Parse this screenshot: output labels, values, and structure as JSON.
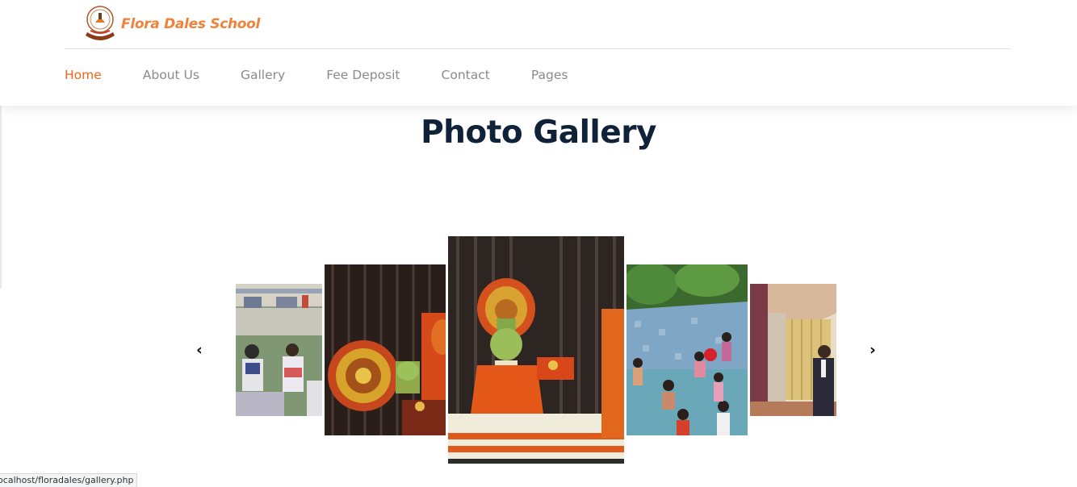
{
  "header": {
    "brand": "Flora Dales School",
    "nav": [
      {
        "label": "Home",
        "active": true
      },
      {
        "label": "About Us",
        "active": false
      },
      {
        "label": "Gallery",
        "active": false
      },
      {
        "label": "Fee Deposit",
        "active": false
      },
      {
        "label": "Contact",
        "active": false
      },
      {
        "label": "Pages",
        "active": false
      }
    ]
  },
  "main": {
    "title": "Photo Gallery",
    "carousel": {
      "prev_icon": "‹",
      "next_icon": "›",
      "slides": [
        {
          "subject": "students-reading-on-lawn"
        },
        {
          "subject": "kathakali-dancer-side"
        },
        {
          "subject": "kathakali-dancer-center"
        },
        {
          "subject": "children-in-swimming-pool"
        },
        {
          "subject": "student-at-stage-curtain"
        }
      ]
    }
  },
  "statusbar": {
    "url": "localhost/floradales/gallery.php"
  },
  "colors": {
    "accent": "#f1661b",
    "title": "#0f2238",
    "nav_text": "#8a8a8a",
    "brand": "#f0823a"
  }
}
